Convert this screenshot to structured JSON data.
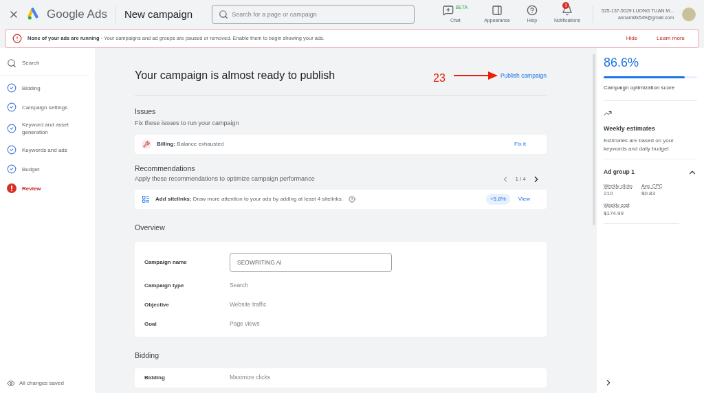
{
  "header": {
    "brand": "Google Ads",
    "page_title": "New campaign",
    "search": {
      "placeholder": "Search for a page or campaign"
    },
    "actions": [
      {
        "kind": "chat",
        "label": "Chat",
        "badge": "BETA"
      },
      {
        "kind": "appearance",
        "label": "Appearance"
      },
      {
        "kind": "help",
        "label": "Help"
      },
      {
        "kind": "notifications",
        "label": "Notifications",
        "badge": "!"
      }
    ],
    "account": {
      "name": "525-137-5029 LUONG TUAN M...",
      "email": "annamktk549@gmail.com"
    }
  },
  "banner": {
    "title": "None of your ads are running",
    "separator": "-",
    "message": "Your campaigns and ad groups are paused or removed. Enable them to begin showing your ads.",
    "actions": [
      "Hide",
      "Learn more"
    ]
  },
  "sidebar": {
    "items": [
      {
        "kind": "search",
        "label": "Search",
        "selected": false
      },
      {
        "kind": "done",
        "label": "Bidding",
        "selected": false
      },
      {
        "kind": "done",
        "label": "Campaign settings",
        "selected": false
      },
      {
        "kind": "done",
        "label": "Keyword and asset generation",
        "selected": false
      },
      {
        "kind": "done",
        "label": "Keywords and ads",
        "selected": false
      },
      {
        "kind": "done",
        "label": "Budget",
        "selected": false
      },
      {
        "kind": "error",
        "label": "Review",
        "selected": true
      }
    ],
    "footer": "All changes saved"
  },
  "main": {
    "title": "Your campaign is almost ready to publish",
    "publish": "Publish campaign",
    "annotation": "23",
    "issues": {
      "title": "Issues",
      "subtitle": "Fix these issues to run your campaign",
      "items": [
        {
          "label": "Billing:",
          "text": "Balance exhausted",
          "action": "Fix it"
        }
      ]
    },
    "recommendations": {
      "title": "Recommendations",
      "subtitle": "Apply these recommendations to optimize campaign performance",
      "pager": "1 / 4",
      "items": [
        {
          "label": "Add sitelinks:",
          "text": "Draw more attention to your ads by adding at least 4 sitelinks.",
          "uplift": "+5.8%",
          "action": "View"
        }
      ]
    },
    "overview": {
      "title": "Overview",
      "rows": [
        {
          "kind": "input",
          "label": "Campaign name",
          "value": "SEOWRITING AI"
        },
        {
          "kind": "text",
          "label": "Campaign type",
          "value": "Search"
        },
        {
          "kind": "text",
          "label": "Objective",
          "value": "Website traffic"
        },
        {
          "kind": "text",
          "label": "Goal",
          "value": "Page views"
        }
      ]
    },
    "bidding": {
      "title": "Bidding",
      "rows": [
        {
          "label": "Bidding",
          "value": "Maximize clicks"
        }
      ]
    }
  },
  "right_panel": {
    "score": "86.6%",
    "level": 0.866,
    "score_label": "Campaign optimization score",
    "weekly_title": "Weekly estimates",
    "weekly_text": "Estimates are based on your keywords and daily budget",
    "ad_group": {
      "title": "Ad group 1",
      "expanded": true,
      "metrics": [
        {
          "label": "Weekly clicks",
          "value": "210"
        },
        {
          "label": "Avg. CPC",
          "value": "$0.83"
        },
        {
          "label": "Weekly cost",
          "value": "$174.99"
        }
      ]
    }
  }
}
